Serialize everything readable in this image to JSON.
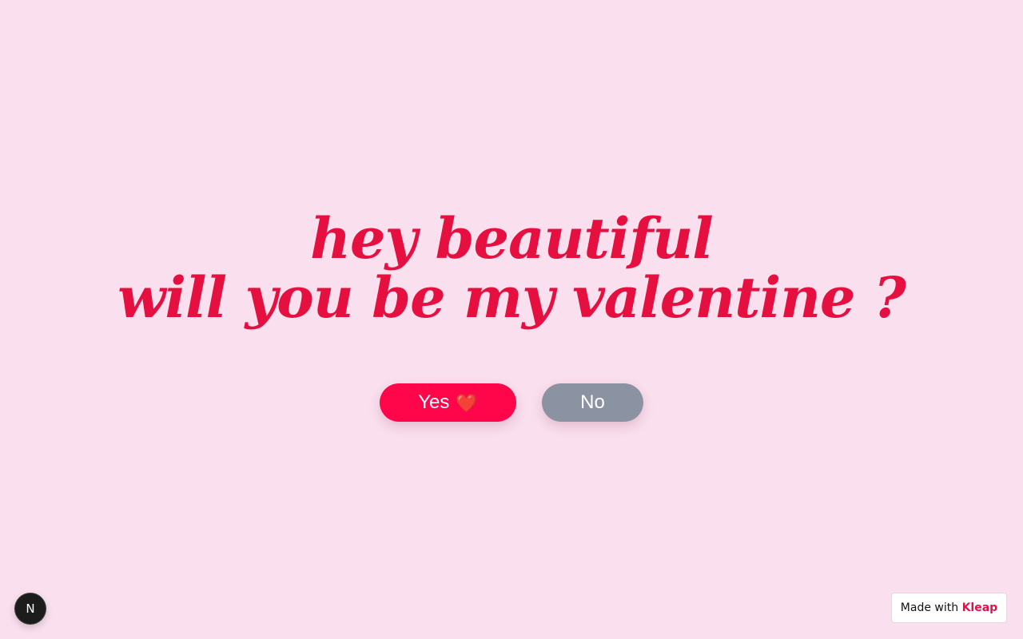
{
  "question": {
    "line1": "hey beautiful",
    "line2": "will you be my valentine ?"
  },
  "buttons": {
    "yes_label": "Yes",
    "yes_emoji": "❤️",
    "no_label": "No"
  },
  "badges": {
    "next_letter": "N",
    "made_with_prefix": "Made with",
    "made_with_brand": "Kleap"
  },
  "colors": {
    "background": "#fadfee",
    "heading": "#e5103f",
    "yes_button": "#ff0549",
    "no_button": "#8b92a1",
    "brand": "#e5104a"
  },
  "icons": {
    "heart": "heart-icon",
    "next": "nextjs-logo-icon"
  }
}
